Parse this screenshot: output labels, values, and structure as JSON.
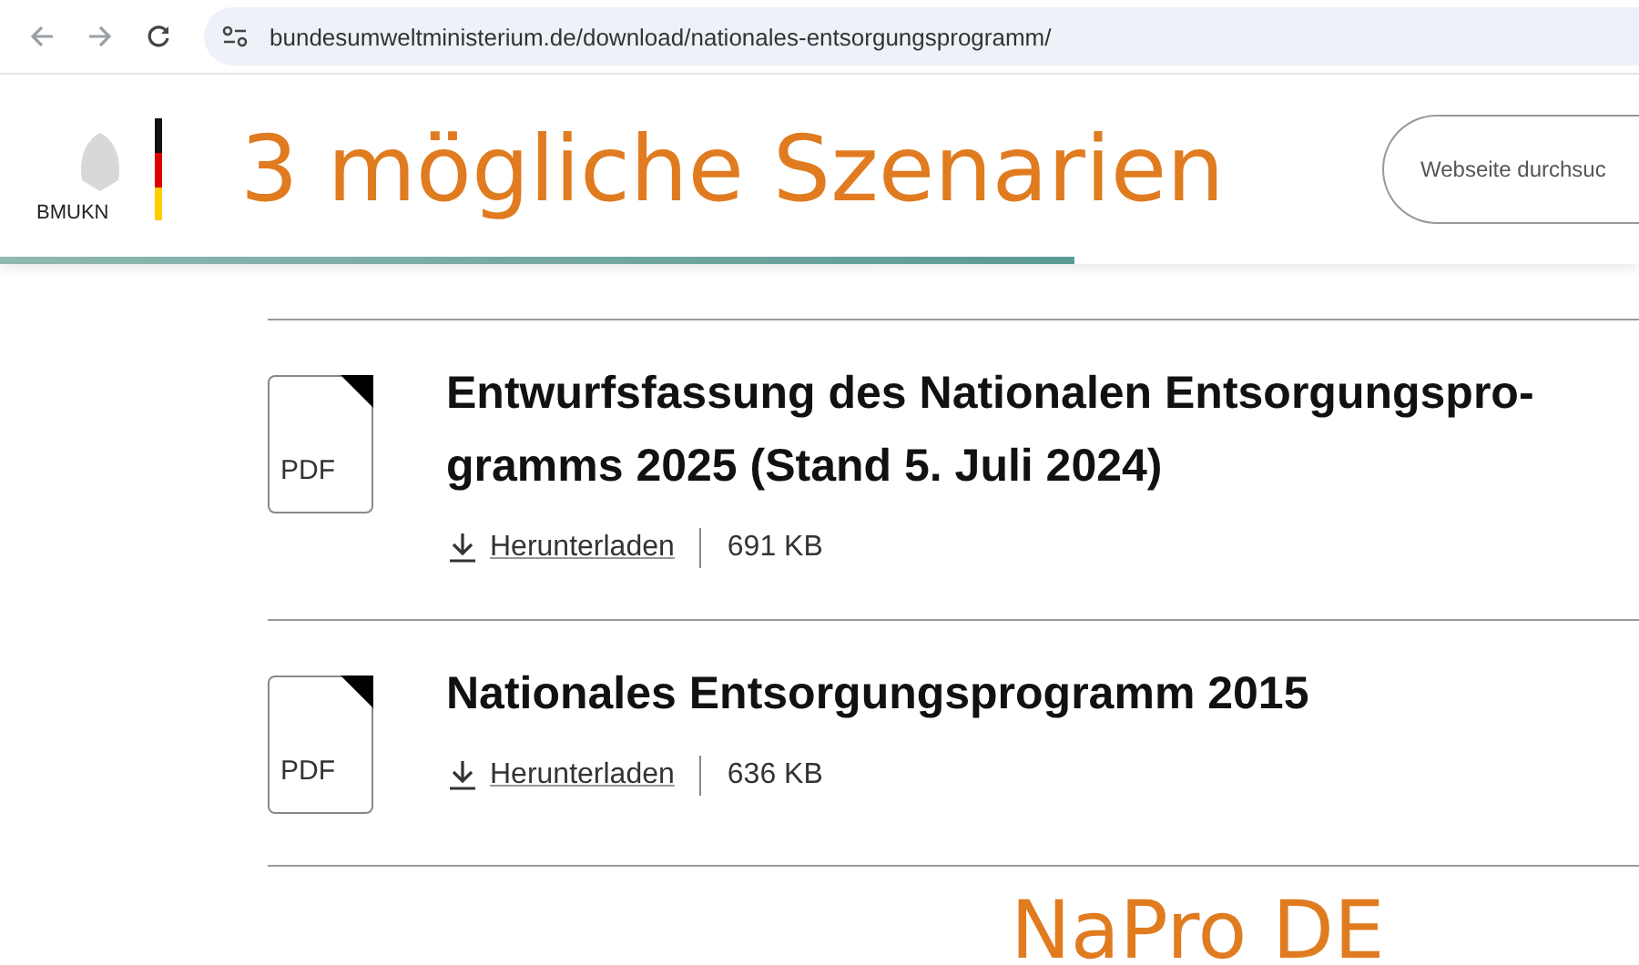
{
  "browser": {
    "url": "bundesumweltministerium.de/download/nationales-entsorgungsprogramm/"
  },
  "header": {
    "logo_text": "BMUKN",
    "overlay_title": "3 mögliche Szenarien",
    "search": {
      "placeholder": "Webseite durchsuc"
    },
    "scroll_progress": {
      "level": 0.655
    }
  },
  "downloads": [
    {
      "file_type": "PDF",
      "lines": [
        "Entwurfsfassung des Nationalen Entsorgungspro-",
        "gramms 2025 (Stand 5. Juli 2024)"
      ],
      "link": "Herunterladen",
      "size": "691 KB"
    },
    {
      "file_type": "PDF",
      "lines": [
        "Nationales Entsorgungsprogramm 2015"
      ],
      "link": "Herunterladen",
      "size": "636 KB"
    }
  ],
  "overlay_caption": "NaPro DE"
}
